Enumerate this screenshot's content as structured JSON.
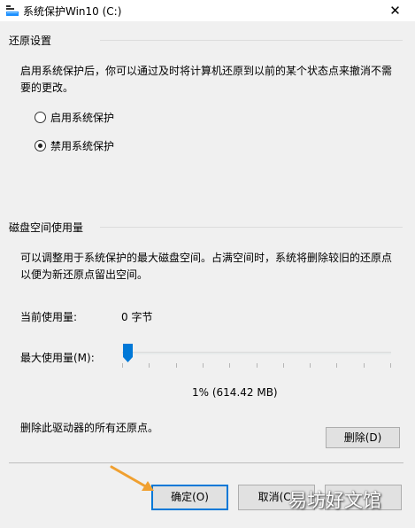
{
  "window": {
    "title": "系统保护Win10 (C:)",
    "close_glyph": "✕"
  },
  "restore_settings": {
    "header": "还原设置",
    "description_line1": "启用系统保护后，你可以通过及时将计算机还原到以前的某个状态点来撤消不需",
    "description_line2": "要的更改。",
    "options": [
      {
        "label": "启用系统保护",
        "selected": false
      },
      {
        "label": "禁用系统保护",
        "selected": true
      }
    ]
  },
  "disk_usage": {
    "header": "磁盘空间使用量",
    "description_line1": "可以调整用于系统保护的最大磁盘空间。占满空间时，系统将删除较旧的还原点",
    "description_line2": "以便为新还原点留出空间。",
    "current_label": "当前使用量:",
    "current_value": "0 字节",
    "max_label": "最大使用量(M):",
    "slider_percent": 1,
    "slider_readout": "1% (614.42 MB)",
    "delete_text": "删除此驱动器的所有还原点。",
    "delete_button": "删除(D)"
  },
  "footer": {
    "ok_button": "确定(O)",
    "cancel_button": "取消(C)"
  },
  "watermark": "易坊好文馆",
  "colors": {
    "accent": "#0078d7",
    "arrow": "#f0a030",
    "thumb": "#0078d7"
  }
}
